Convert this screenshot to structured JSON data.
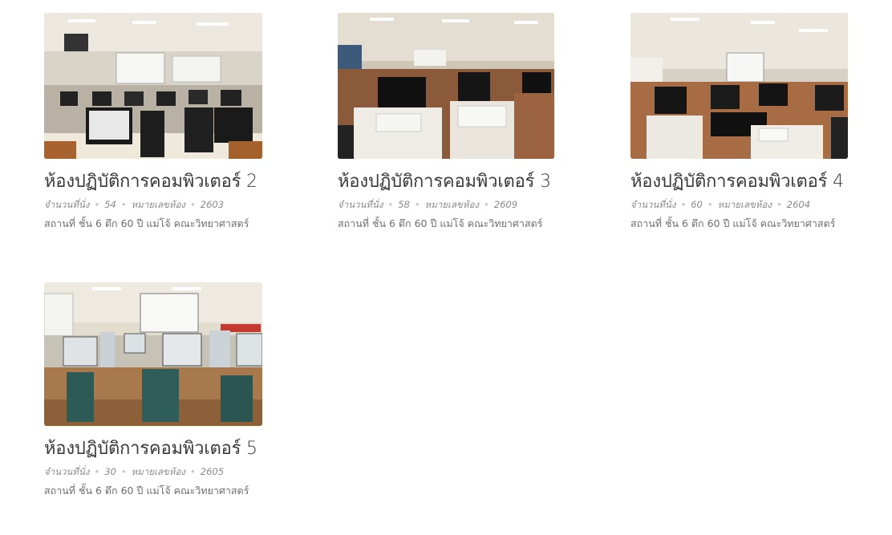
{
  "rooms": [
    {
      "title": "ห้องปฏิบัติการคอมพิวเตอร์ 2",
      "seats_label": "จำนวนที่นั่ง",
      "seats": "54",
      "room_no_label": "หมายเลขห้อง",
      "room_no": "2603",
      "location": "สถานที่ ชั้น 6  ตึก 60 ปี แม่โจ้ คณะวิทยาศาสตร์"
    },
    {
      "title": "ห้องปฏิบัติการคอมพิวเตอร์ 3",
      "seats_label": "จำนวนที่นั่ง",
      "seats": "58",
      "room_no_label": "หมายเลขห้อง",
      "room_no": "2609",
      "location": "สถานที่ ชั้น 6  ตึก 60 ปี แม่โจ้ คณะวิทยาศาสตร์"
    },
    {
      "title": "ห้องปฏิบัติการคอมพิวเตอร์ 4",
      "seats_label": "จำนวนที่นั่ง",
      "seats": "60",
      "room_no_label": "หมายเลขห้อง",
      "room_no": "2604",
      "location": "สถานที่ ชั้น 6  ตึก 60 ปี แม่โจ้ คณะวิทยาศาสตร์"
    },
    {
      "title": "ห้องปฏิบัติการคอมพิวเตอร์ 5",
      "seats_label": "จำนวนที่นั่ง",
      "seats": "30",
      "room_no_label": "หมายเลขห้อง",
      "room_no": "2605",
      "location": "สถานที่ ชั้น 6  ตึก 60 ปี แม่โจ้ คณะวิทยาศาสตร์"
    }
  ],
  "meta_separator": "•"
}
